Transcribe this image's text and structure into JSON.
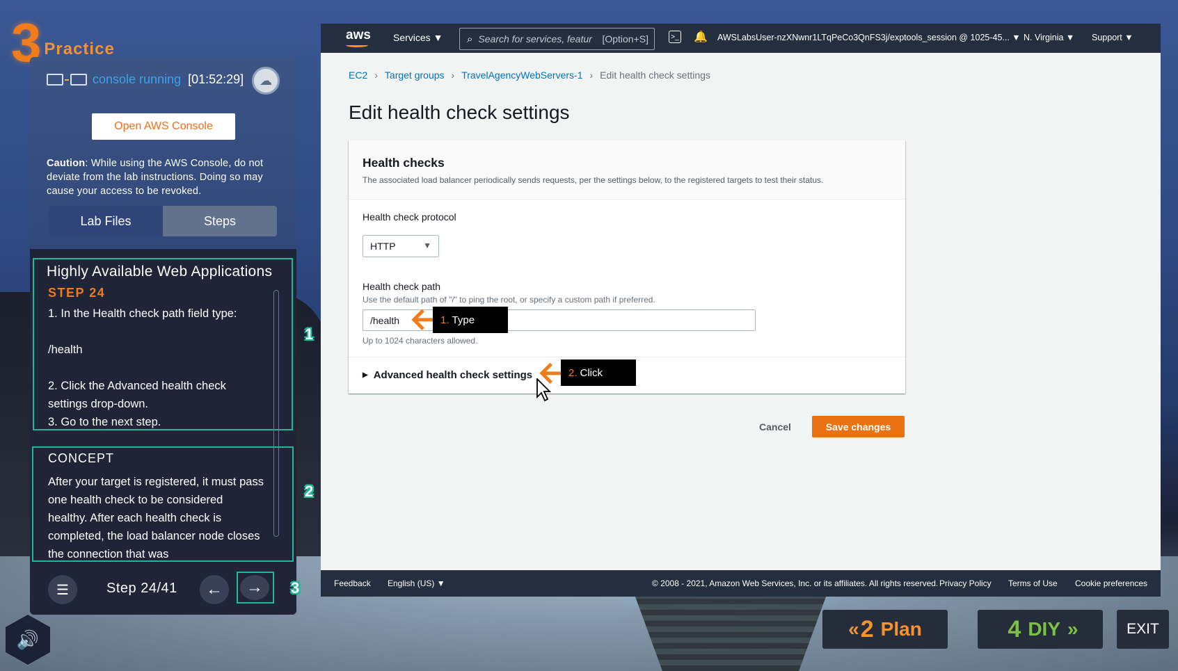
{
  "practice": {
    "number": "3",
    "label": "Practice"
  },
  "console": {
    "status": "console running",
    "timer": "[01:52:29]",
    "open_button": "Open AWS Console"
  },
  "caution": {
    "bold": "Caution",
    "text": ": While using the AWS Console, do not deviate from the lab instructions. Doing so may cause your access to be revoked."
  },
  "tabs": [
    {
      "label": "Lab Files"
    },
    {
      "label": "Steps"
    }
  ],
  "step": {
    "title": "Highly Available Web Applications",
    "label": "STEP 24",
    "lines": [
      "1. In the Health check path field type:",
      "",
      "/health",
      "",
      "2. Click the Advanced health check",
      "settings drop-down.",
      "3. Go to the next step."
    ]
  },
  "concept": {
    "title": "CONCEPT",
    "text": "After your target is registered, it must pass one health check to be considered healthy. After each health check is completed, the load balancer node closes the connection that was"
  },
  "nav": {
    "step_counter": "Step 24/41",
    "prev": "←",
    "next": "→",
    "menu": "☰"
  },
  "markers": [
    "1",
    "2",
    "3"
  ],
  "aws": {
    "logo": "aws",
    "services": "Services ▼",
    "search_placeholder": "Search for services, featur",
    "search_shortcut": "[Option+S]",
    "user": "AWSLabsUser-nzXNwnr1LTqPeCo3QnFS3j/exptools_session @ 1025-45... ▼",
    "region": "N. Virginia ▼",
    "support": "Support ▼",
    "breadcrumbs": [
      "EC2",
      "Target groups",
      "TravelAgencyWebServers-1",
      "Edit health check settings"
    ],
    "page_title": "Edit health check settings",
    "card": {
      "title": "Health checks",
      "description": "The associated load balancer periodically sends requests, per the settings below, to the registered targets to test their status.",
      "protocol_label": "Health check protocol",
      "protocol_value": "HTTP",
      "path_label": "Health check path",
      "path_hint": "Use the default path of \"/\" to ping the root, or specify a custom path if preferred.",
      "path_value": "/health",
      "path_limit": "Up to 1024 characters allowed.",
      "advanced": "Advanced health check settings"
    },
    "annotations": [
      {
        "num": "1.",
        "text": "Type"
      },
      {
        "num": "2.",
        "text": "Click"
      }
    ],
    "cancel": "Cancel",
    "save": "Save changes",
    "footer": {
      "feedback": "Feedback",
      "language": "English (US) ▼",
      "copyright": "© 2008 - 2021, Amazon Web Services, Inc. or its affiliates. All rights reserved.",
      "privacy": "Privacy Policy",
      "terms": "Terms of Use",
      "cookies": "Cookie preferences"
    }
  },
  "bottom": {
    "plan": {
      "num": "2",
      "label": "Plan"
    },
    "diy": {
      "num": "4",
      "label": "DIY"
    },
    "exit": "EXIT"
  },
  "colors": {
    "accent_orange": "#f07c1c",
    "teal": "#1fb899",
    "aws_nav": "#232f3e",
    "save_orange": "#ec7211"
  }
}
